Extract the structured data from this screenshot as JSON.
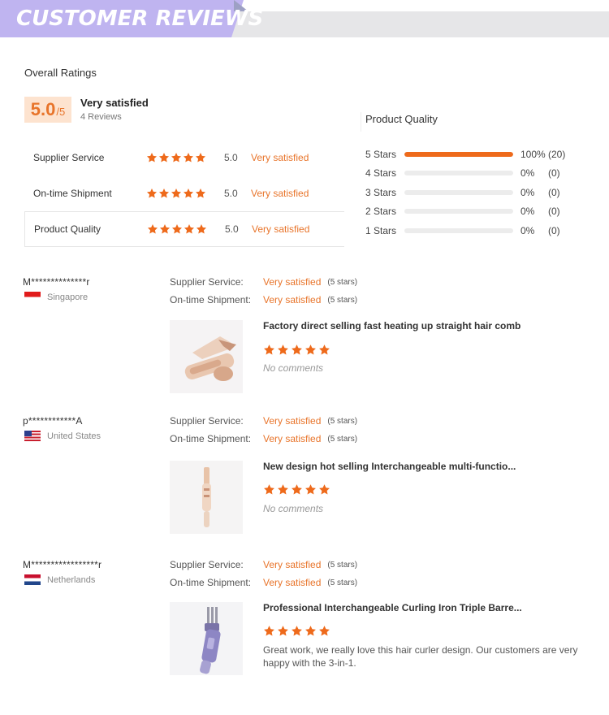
{
  "header": {
    "title": "CUSTOMER REVIEWS"
  },
  "overall": {
    "title": "Overall Ratings",
    "score": "5.0",
    "score_max": "/5",
    "label": "Very satisfied",
    "count": "4 Reviews",
    "categories": [
      {
        "name": "Supplier Service",
        "score": "5.0",
        "label": "Very satisfied",
        "stars": 5
      },
      {
        "name": "On-time Shipment",
        "score": "5.0",
        "label": "Very satisfied",
        "stars": 5
      },
      {
        "name": "Product Quality",
        "score": "5.0",
        "label": "Very satisfied",
        "stars": 5
      }
    ]
  },
  "quality": {
    "title": "Product Quality",
    "rows": [
      {
        "label": "5 Stars",
        "percent": "100%",
        "count": "(20)",
        "fraction": 1.0
      },
      {
        "label": "4 Stars",
        "percent": "0%",
        "count": "(0)",
        "fraction": 0
      },
      {
        "label": "3 Stars",
        "percent": "0%",
        "count": "(0)",
        "fraction": 0
      },
      {
        "label": "2 Stars",
        "percent": "0%",
        "count": "(0)",
        "fraction": 0
      },
      {
        "label": "1 Stars",
        "percent": "0%",
        "count": "(0)",
        "fraction": 0
      }
    ]
  },
  "reviews": [
    {
      "user": "M**************r",
      "country": "Singapore",
      "supplier_label": "Supplier Service:",
      "supplier_value": "Very satisfied",
      "supplier_stars": "(5 stars)",
      "shipment_label": "On-time Shipment:",
      "shipment_value": "Very satisfied",
      "shipment_stars": "(5 stars)",
      "product": "Factory direct selling fast heating up straight hair comb",
      "rating": 5,
      "comment": "No comments"
    },
    {
      "user": "p************A",
      "country": "United States",
      "supplier_label": "Supplier Service:",
      "supplier_value": "Very satisfied",
      "supplier_stars": "(5 stars)",
      "shipment_label": "On-time Shipment:",
      "shipment_value": "Very satisfied",
      "shipment_stars": "(5 stars)",
      "product": "New design hot selling Interchangeable multi-functio...",
      "rating": 5,
      "comment": "No comments"
    },
    {
      "user": "M*****************r",
      "country": "Netherlands",
      "supplier_label": "Supplier Service:",
      "supplier_value": "Very satisfied",
      "supplier_stars": "(5 stars)",
      "shipment_label": "On-time Shipment:",
      "shipment_value": "Very satisfied",
      "shipment_stars": "(5 stars)",
      "product": "Professional Interchangeable Curling Iron Triple Barre...",
      "rating": 5,
      "comment": "Great work, we really love this hair curler design. Our customers are very happy with the 3-in-1."
    }
  ],
  "colors": {
    "accent": "#e8742a",
    "banner": "#bfb4f0",
    "star": "#ee6a1b",
    "bar": "#ee6a1b"
  }
}
